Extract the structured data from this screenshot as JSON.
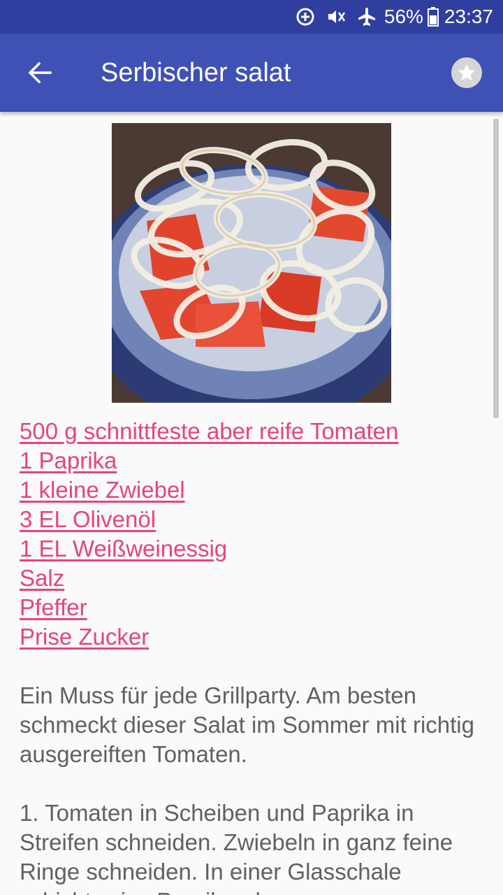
{
  "status_bar": {
    "icons": [
      "data-saver-icon",
      "vibrate-icon",
      "airplane-mode-icon",
      "battery-icon"
    ],
    "battery": "56%",
    "time": "23:37"
  },
  "app_bar": {
    "back_icon": "arrow-back-icon",
    "title": "Serbischer salat",
    "favorite_icon": "star-icon"
  },
  "recipe": {
    "ingredients": [
      "500 g schnittfeste aber reife Tomaten",
      "1 Paprika",
      "1 kleine Zwiebel",
      "3 EL Olivenöl",
      "1 EL Weißweinessig",
      "Salz",
      "Pfeffer",
      "Prise Zucker"
    ],
    "intro": "Ein Muss für jede Grillparty. Am besten schmeckt dieser Salat im Sommer mit richtig ausgereiften Tomaten.",
    "instructions": "1. Tomaten in Scheiben und Paprika in Streifen schneiden. Zwiebeln in ganz feine Ringe schneiden. In einer Glasschale schichtweise Paprika, dann"
  },
  "colors": {
    "status_bar": "#303f9f",
    "app_bar": "#3f51b5",
    "link": "#e8437a",
    "body_text": "#616161",
    "background": "#fafafa"
  }
}
